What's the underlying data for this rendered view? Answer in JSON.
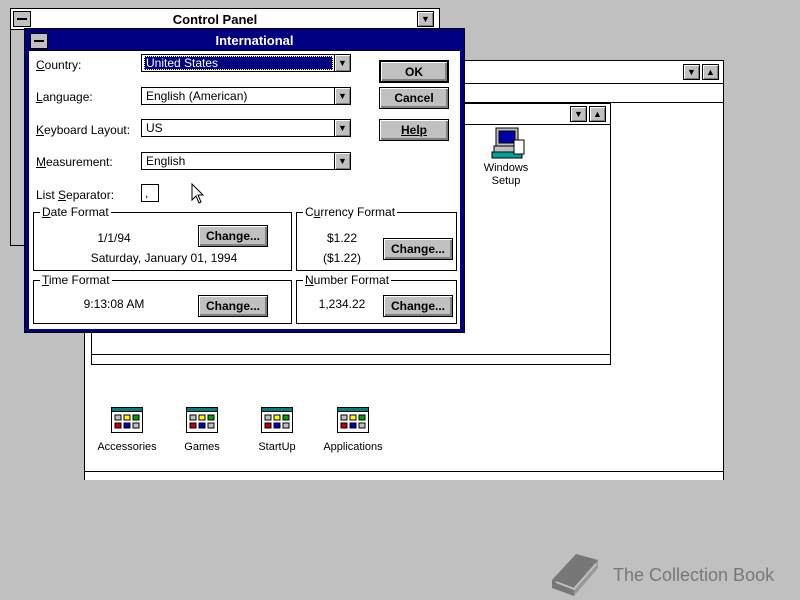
{
  "control_panel": {
    "title": "Control Panel"
  },
  "program_manager": {
    "groups": [
      {
        "label": "Accessories"
      },
      {
        "label": "Games"
      },
      {
        "label": "StartUp"
      },
      {
        "label": "Applications"
      }
    ],
    "windows_setup_line1": "Windows",
    "windows_setup_line2": "Setup"
  },
  "dialog": {
    "title": "International",
    "country": {
      "label": "Country:",
      "value": "United States"
    },
    "language": {
      "label": "Language:",
      "value": "English (American)"
    },
    "keyboard": {
      "label": "Keyboard Layout:",
      "value": "US"
    },
    "measurement": {
      "label": "Measurement:",
      "value": "English"
    },
    "list_separator": {
      "label": "List Separator:",
      "value": ","
    },
    "buttons": {
      "ok": "OK",
      "cancel": "Cancel",
      "help": "Help"
    },
    "date_format": {
      "title": "Date Format",
      "short": "1/1/94",
      "long": "Saturday, January 01, 1994",
      "change": "Change..."
    },
    "currency_format": {
      "title": "Currency Format",
      "positive": "$1.22",
      "negative": "($1.22)",
      "change": "Change..."
    },
    "time_format": {
      "title": "Time Format",
      "value": "9:13:08 AM",
      "change": "Change..."
    },
    "number_format": {
      "title": "Number Format",
      "value": "1,234.22",
      "change": "Change..."
    }
  },
  "watermark": {
    "text": "The Collection Book"
  },
  "colors": {
    "titlebar": "#000080",
    "desktop": "#c0c0c0",
    "watermark": "#777777"
  }
}
